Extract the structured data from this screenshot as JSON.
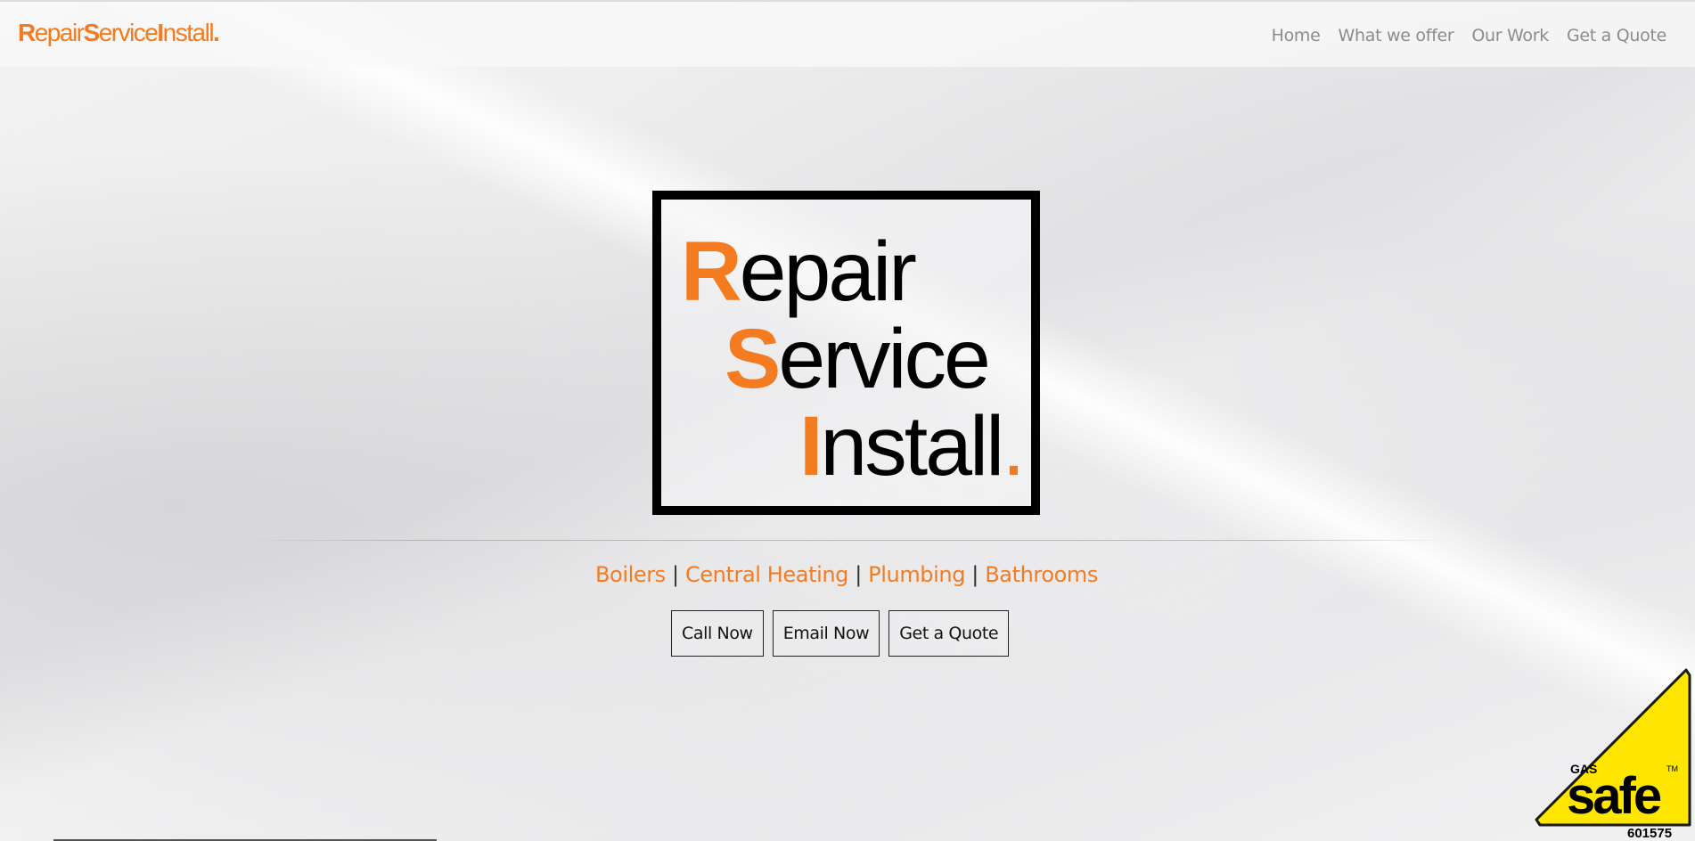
{
  "brand": {
    "prefix_r": "R",
    "part1": "epair",
    "prefix_s": "S",
    "part2": "ervice",
    "prefix_i": "I",
    "part3": "nstall",
    "dot": "."
  },
  "nav": {
    "items": [
      {
        "label": "Home"
      },
      {
        "label": "What we offer"
      },
      {
        "label": "Our Work"
      },
      {
        "label": "Get a Quote"
      }
    ]
  },
  "logo": {
    "line1_cap": "R",
    "line1_rest": "epair",
    "line2_cap": "S",
    "line2_rest": "ervice",
    "line3_cap": "I",
    "line3_rest": "nstall",
    "dot": "."
  },
  "services": {
    "items": [
      "Boilers",
      "Central Heating",
      "Plumbing",
      "Bathrooms"
    ],
    "separator": "|"
  },
  "actions": {
    "call_label": "Call Now",
    "email_label": "Email Now",
    "quote_label": "Get a Quote"
  },
  "badge": {
    "top_text": "GAS",
    "main_text": "safe",
    "tm": "TM",
    "number": "601575"
  },
  "colors": {
    "accent": "#f47b20",
    "badge_yellow": "#ffe600",
    "text_dark": "#000000",
    "nav_text": "#8c8c8c"
  }
}
